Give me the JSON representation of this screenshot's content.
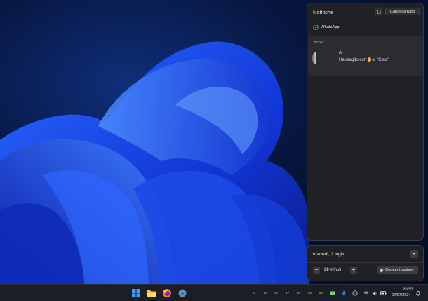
{
  "notifications": {
    "title": "Notifiche",
    "clear_all_label": "Cancella tutto",
    "app_name": "WhatsApp",
    "time": "20:52",
    "sender": "Ai",
    "message_prefix": "Ha reagito con",
    "message_suffix": "a: \"Ciao\""
  },
  "calendar": {
    "date_label": "martedì, 2 luglio",
    "minutes_value": "30",
    "minutes_unit": "minuti",
    "focus_label": "Concentrazione",
    "minus_label": "−",
    "plus_label": "+"
  },
  "taskbar": {
    "apps": [
      "start-icon",
      "file-explorer-icon",
      "firefox-icon",
      "settings-icon"
    ],
    "tray_numbers": [
      "43",
      "43",
      "47",
      "48",
      "50",
      "64"
    ],
    "clock_time": "20:53",
    "clock_date": "02/07/2024"
  },
  "colors": {
    "panel_bg": "#202124",
    "card_bg": "#2b2c30",
    "taskbar_bg": "#1c1e26",
    "whatsapp_green": "#25d366"
  }
}
